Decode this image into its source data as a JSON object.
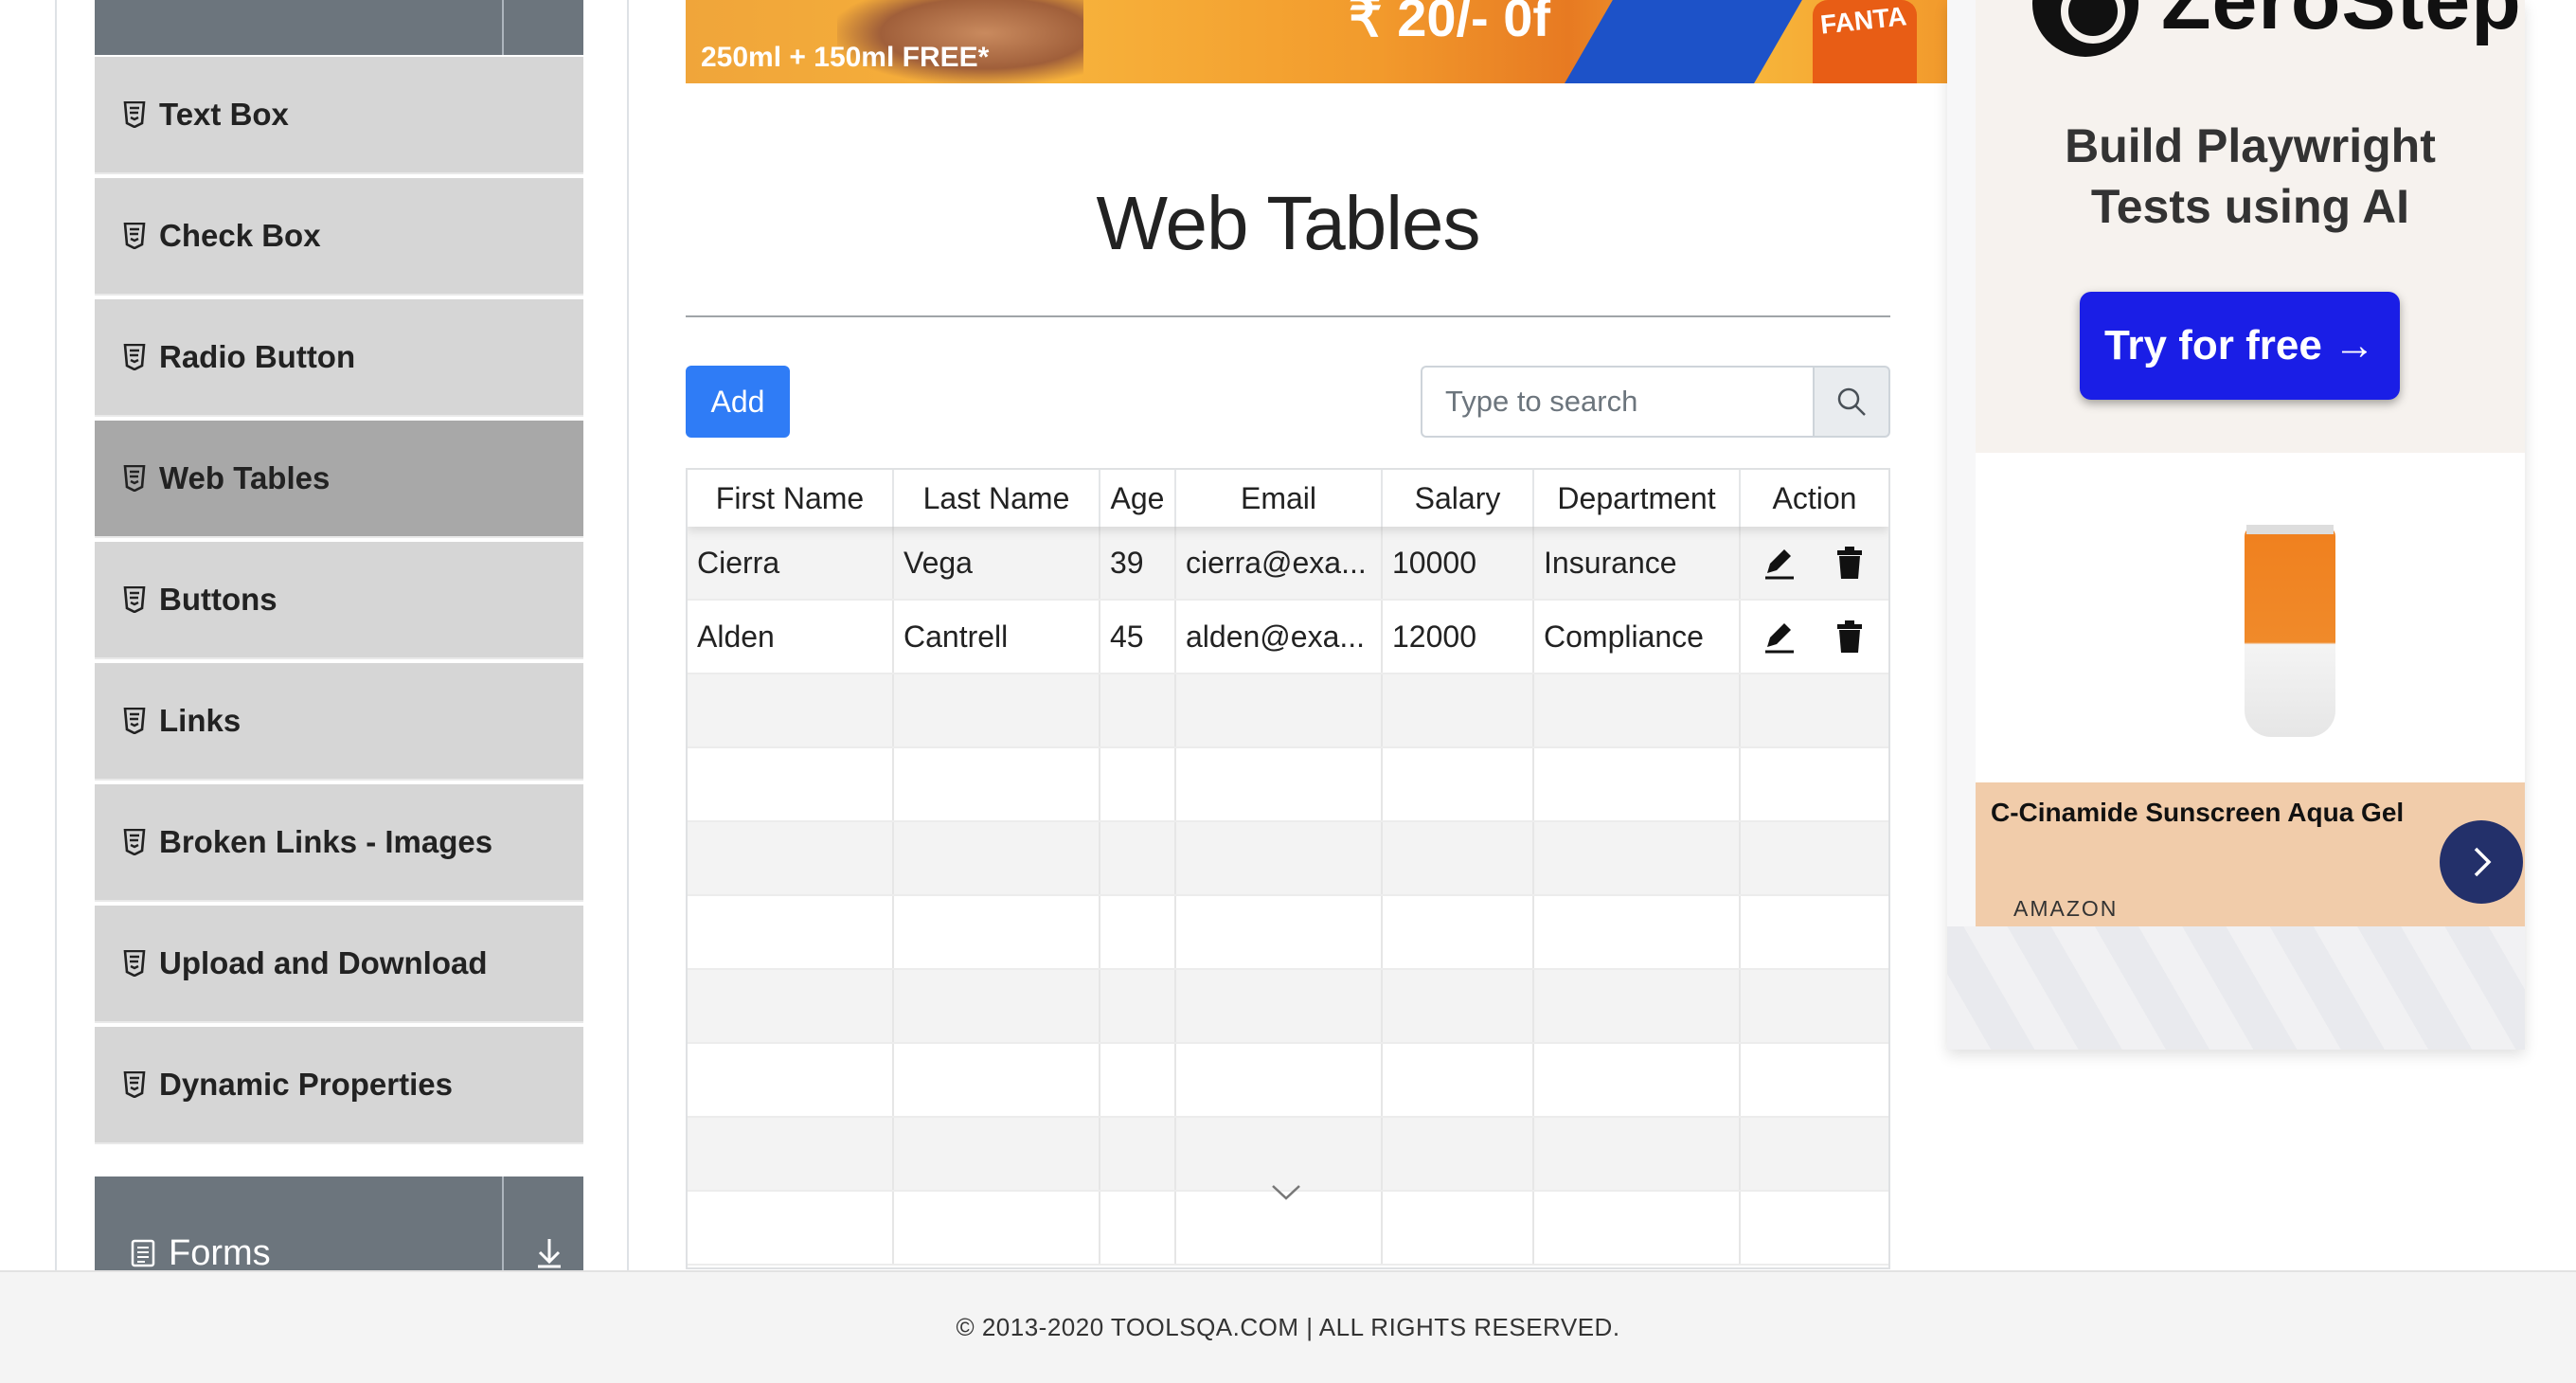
{
  "sidebar": {
    "items": [
      {
        "label": "Text Box",
        "icon": "html5-icon",
        "active": false
      },
      {
        "label": "Check Box",
        "icon": "html5-icon",
        "active": false
      },
      {
        "label": "Radio Button",
        "icon": "html5-icon",
        "active": false
      },
      {
        "label": "Web Tables",
        "icon": "html5-icon",
        "active": true
      },
      {
        "label": "Buttons",
        "icon": "html5-icon",
        "active": false
      },
      {
        "label": "Links",
        "icon": "html5-icon",
        "active": false
      },
      {
        "label": "Broken Links - Images",
        "icon": "html5-icon",
        "active": false
      },
      {
        "label": "Upload and Download",
        "icon": "html5-icon",
        "active": false
      },
      {
        "label": "Dynamic Properties",
        "icon": "html5-icon",
        "active": false
      }
    ],
    "forms_group": {
      "label": "Forms",
      "icon": "document-icon",
      "toggle_icon": "arrow-down-icon"
    }
  },
  "banner": {
    "promo_text": "250ml + 150ml FREE*",
    "price_text": "₹ 20/- 0f",
    "brand_text": "FANTA"
  },
  "main": {
    "title": "Web Tables",
    "add_label": "Add",
    "search": {
      "placeholder": "Type to search",
      "value": ""
    },
    "table": {
      "columns": [
        "First Name",
        "Last Name",
        "Age",
        "Email",
        "Salary",
        "Department",
        "Action"
      ],
      "rows": [
        [
          "Cierra",
          "Vega",
          "39",
          "cierra@exa...",
          "10000",
          "Insurance"
        ],
        [
          "Alden",
          "Cantrell",
          "45",
          "alden@exa...",
          "12000",
          "Compliance"
        ]
      ],
      "row_actions": [
        "edit-icon",
        "delete-icon"
      ]
    }
  },
  "ad": {
    "logo_text": "ZeroStep",
    "headline_line1": "Build Playwright",
    "headline_line2": "Tests using AI",
    "cta_label": "Try for free →",
    "product_name": "C-Cinamide Sunscreen Aqua Gel",
    "vendor": "AMAZON",
    "colors": {
      "cta": "#1a1ee6",
      "card": "#f1ccaa",
      "arrow_button": "#23306a"
    }
  },
  "footer": {
    "text": "© 2013-2020 TOOLSQA.COM | ALL RIGHTS RESERVED."
  },
  "colors": {
    "primary_button": "#2f7cf6",
    "sidebar_item": "#d6d6d6",
    "sidebar_active": "#a8a8a8",
    "group_header": "#6c757d"
  }
}
